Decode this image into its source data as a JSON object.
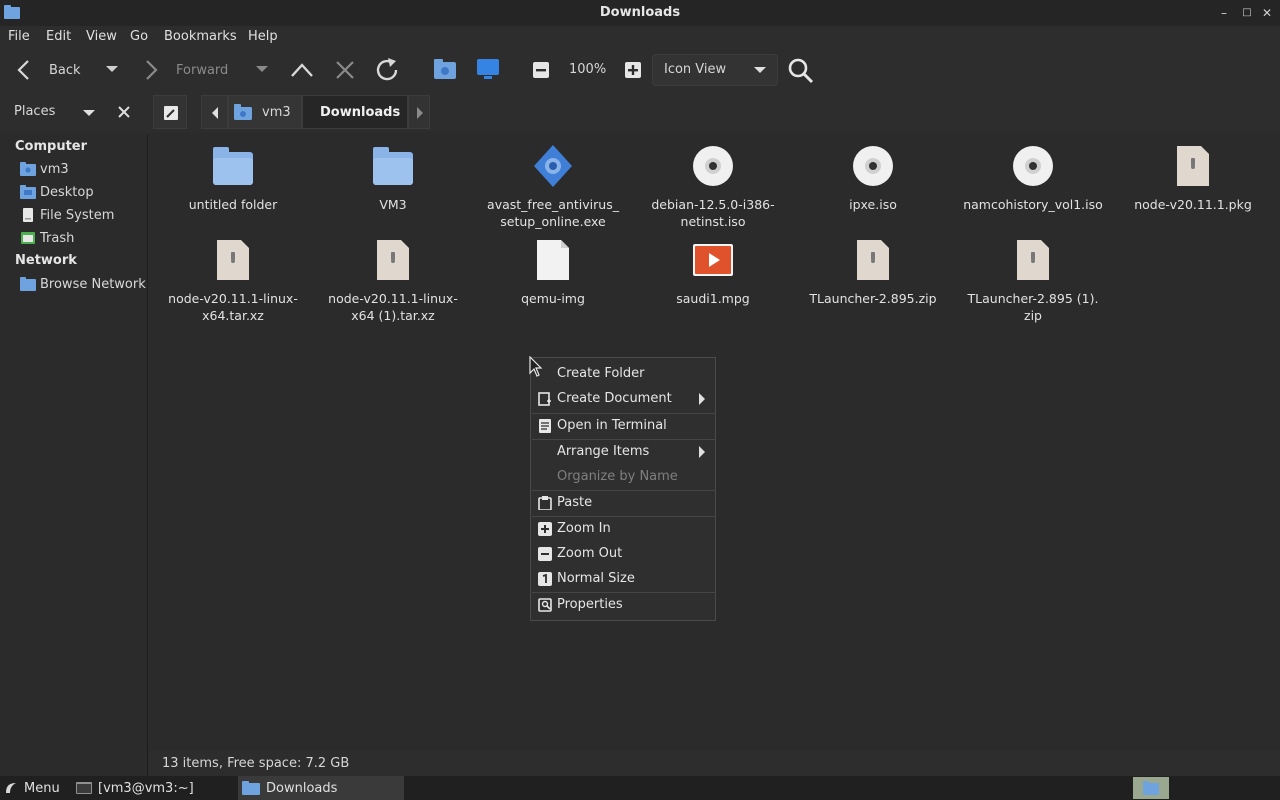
{
  "window": {
    "title": "Downloads"
  },
  "menubar": [
    "File",
    "Edit",
    "View",
    "Go",
    "Bookmarks",
    "Help"
  ],
  "toolbar": {
    "back_label": "Back",
    "forward_label": "Forward",
    "zoom_level": "100%",
    "view_mode": "Icon View"
  },
  "location": {
    "places_label": "Places",
    "crumbs": [
      "vm3",
      "Downloads"
    ]
  },
  "sidebar": {
    "computer_heading": "Computer",
    "computer_items": [
      "vm3",
      "Desktop",
      "File System",
      "Trash"
    ],
    "network_heading": "Network",
    "network_items": [
      "Browse Network"
    ]
  },
  "files": [
    {
      "name": "untitled folder",
      "icon": "folder-icon"
    },
    {
      "name": "VM3",
      "icon": "folder-icon"
    },
    {
      "name": "avast_free_antivirus_\nsetup_online.exe",
      "icon": "executable-icon"
    },
    {
      "name": "debian-12.5.0-i386-\nnetinst.iso",
      "icon": "disc-icon"
    },
    {
      "name": "ipxe.iso",
      "icon": "disc-icon"
    },
    {
      "name": "namcohistory_vol1.iso",
      "icon": "disc-icon"
    },
    {
      "name": "node-v20.11.1.pkg",
      "icon": "archive-icon"
    },
    {
      "name": "node-v20.11.1-linux-\nx64.tar.xz",
      "icon": "archive-icon"
    },
    {
      "name": "node-v20.11.1-linux-\nx64 (1).tar.xz",
      "icon": "archive-icon"
    },
    {
      "name": "qemu-img",
      "icon": "file-icon"
    },
    {
      "name": "saudi1.mpg",
      "icon": "video-icon"
    },
    {
      "name": "TLauncher-2.895.zip",
      "icon": "archive-icon"
    },
    {
      "name": "TLauncher-2.895 (1).\nzip",
      "icon": "archive-icon"
    }
  ],
  "context_menu": {
    "items": [
      {
        "label": "Create Folder",
        "icon": "",
        "submenu": false,
        "disabled": false
      },
      {
        "label": "Create Document",
        "icon": "create-document-icon",
        "submenu": true,
        "disabled": false
      },
      {
        "label": "Open in Terminal",
        "icon": "terminal-icon",
        "submenu": false,
        "disabled": false
      },
      {
        "label": "Arrange Items",
        "icon": "",
        "submenu": true,
        "disabled": false
      },
      {
        "label": "Organize by Name",
        "icon": "",
        "submenu": false,
        "disabled": true
      },
      {
        "label": "Paste",
        "icon": "paste-icon",
        "submenu": false,
        "disabled": false
      },
      {
        "label": "Zoom In",
        "icon": "zoom-in-icon",
        "submenu": false,
        "disabled": false
      },
      {
        "label": "Zoom Out",
        "icon": "zoom-out-icon",
        "submenu": false,
        "disabled": false
      },
      {
        "label": "Normal Size",
        "icon": "normal-size-icon",
        "submenu": false,
        "disabled": false
      },
      {
        "label": "Properties",
        "icon": "properties-icon",
        "submenu": false,
        "disabled": false
      }
    ]
  },
  "statusbar": {
    "text": "13 items, Free space: 7.2 GB"
  },
  "taskbar": {
    "menu_label": "Menu",
    "tasks": [
      "[vm3@vm3:~]",
      "Downloads"
    ]
  },
  "colors": {
    "folder": "#8ab4e8",
    "accent": "#3584e4",
    "background": "#2b2b2b"
  }
}
